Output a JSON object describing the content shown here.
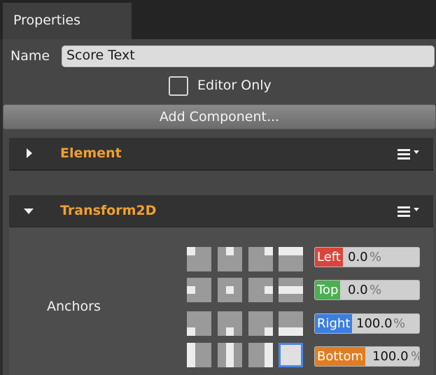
{
  "tab": {
    "label": "Properties"
  },
  "entity": {
    "name_label": "Name",
    "name_value": "Score Text",
    "editor_only_label": "Editor Only",
    "editor_only_checked": false,
    "add_component_label": "Add Component..."
  },
  "components": [
    {
      "title": "Element",
      "expanded": false
    },
    {
      "title": "Transform2D",
      "expanded": true
    }
  ],
  "transform2d": {
    "anchors_label": "Anchors",
    "fields": [
      {
        "tag": "Left",
        "value": "0.0",
        "unit": "%",
        "color": "#d9453c"
      },
      {
        "tag": "Top",
        "value": "0.0",
        "unit": "%",
        "color": "#4caf50"
      },
      {
        "tag": "Right",
        "value": "100.0",
        "unit": "%",
        "color": "#3d7ee0"
      },
      {
        "tag": "Bottom",
        "value": "100.0",
        "unit": "%",
        "color": "#e07d22"
      }
    ],
    "anchor_presets": [
      [
        "top-left",
        "top-center",
        "top-right",
        "top-stretch"
      ],
      [
        "middle-left",
        "middle-center",
        "middle-right",
        "middle-stretch"
      ],
      [
        "bottom-left",
        "bottom-center",
        "bottom-right",
        "bottom-stretch"
      ],
      [
        "stretch-left",
        "stretch-center",
        "stretch-right",
        "stretch-all"
      ]
    ],
    "selected_anchor_preset": "stretch-all"
  },
  "colors": {
    "component_title": "#f0a030",
    "selection_border": "#4a86e8"
  },
  "icons": {
    "collapsed_arrow": "triangle-right-icon",
    "expanded_arrow": "triangle-down-icon",
    "component_menu": "hamburger-menu-icon"
  }
}
